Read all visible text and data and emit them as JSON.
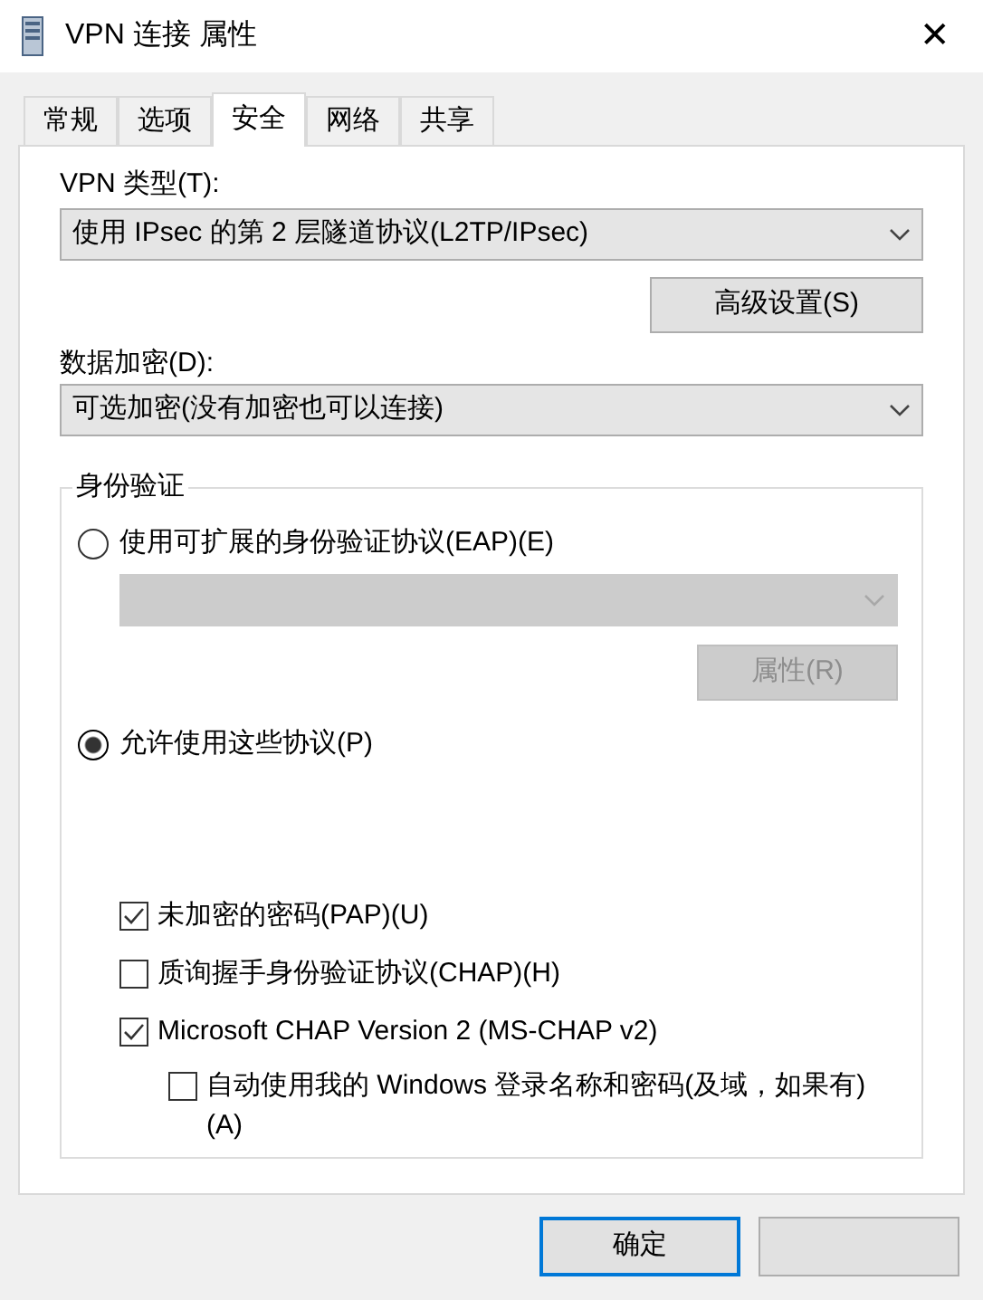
{
  "window": {
    "title": "VPN 连接 属性",
    "close": "✕"
  },
  "tabs": [
    {
      "label": "常规",
      "selected": false
    },
    {
      "label": "选项",
      "selected": false
    },
    {
      "label": "安全",
      "selected": true
    },
    {
      "label": "网络",
      "selected": false
    },
    {
      "label": "共享",
      "selected": false
    }
  ],
  "vpn_type": {
    "label": "VPN 类型(T):",
    "value": "使用 IPsec 的第 2 层隧道协议(L2TP/IPsec)"
  },
  "advanced_button": {
    "label": "高级设置(S)",
    "disabled": false
  },
  "data_encryption": {
    "label": "数据加密(D):",
    "value": "可选加密(没有加密也可以连接)"
  },
  "authentication": {
    "title": "身份验证",
    "options": [
      {
        "label": "使用可扩展的身份验证协议(EAP)(E)",
        "selected": false
      },
      {
        "label": "允许使用这些协议(P)",
        "selected": true
      }
    ],
    "eap_dropdown": {
      "disabled": true
    },
    "properties_button": {
      "label": "属性(R)",
      "disabled": true
    },
    "protocols": [
      {
        "label": "未加密的密码(PAP)(U)",
        "checked": true
      },
      {
        "label": "质询握手身份验证协议(CHAP)(H)",
        "checked": false
      },
      {
        "label": "Microsoft CHAP Version 2 (MS-CHAP v2)",
        "checked": true,
        "children": [
          {
            "label": "自动使用我的 Windows 登录名称和密码(及域，如果有)(A)",
            "checked": false
          }
        ]
      }
    ]
  },
  "buttons": [
    {
      "label": "确定",
      "default": true
    },
    {
      "default": false
    }
  ]
}
